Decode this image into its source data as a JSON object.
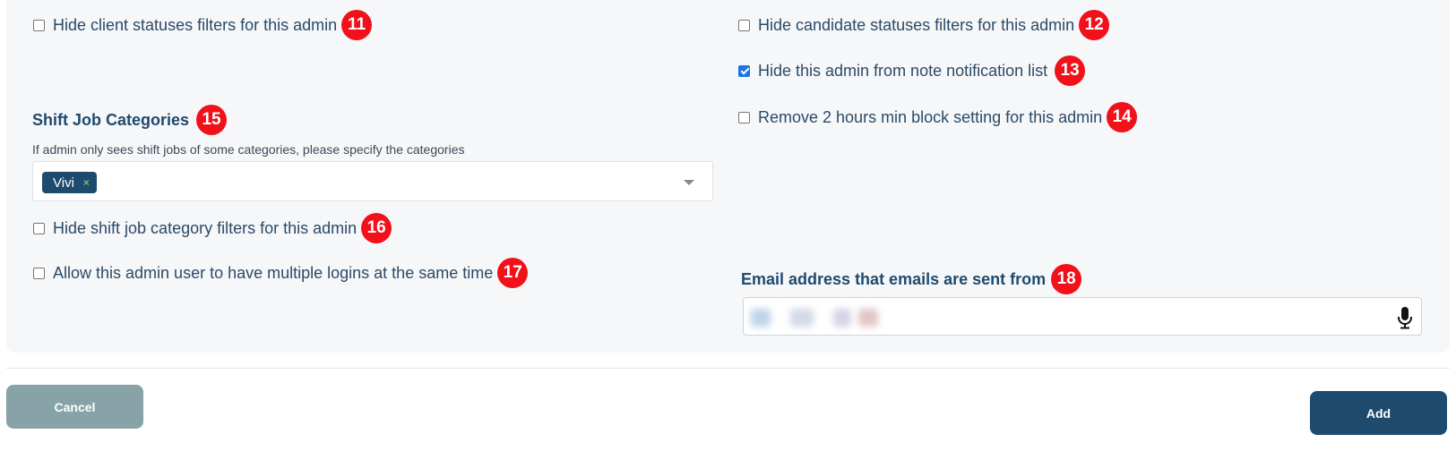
{
  "left_column": {
    "hide_client_statuses": {
      "label": "Hide client statuses filters for this admin",
      "checked": false,
      "badge": "11"
    },
    "shift_job_categories": {
      "heading": "Shift Job Categories",
      "badge": "15",
      "hint": "If admin only sees shift jobs of some categories, please specify the categories",
      "selected_tag": "Vivi",
      "tag_remove": "×"
    },
    "hide_shift_job_category": {
      "label": "Hide shift job category filters for this admin",
      "checked": false,
      "badge": "16"
    },
    "allow_multiple_logins": {
      "label": "Allow this admin user to have multiple logins at the same time",
      "checked": false,
      "badge": "17"
    }
  },
  "right_column": {
    "hide_candidate_statuses": {
      "label": "Hide candidate statuses filters for this admin",
      "checked": false,
      "badge": "12"
    },
    "hide_from_note_notification": {
      "label": "Hide this admin from note notification list",
      "checked": true,
      "badge": "13"
    },
    "remove_min_block": {
      "label": "Remove 2 hours min block setting for this admin",
      "checked": false,
      "badge": "14"
    },
    "email_sender": {
      "heading": "Email address that emails are sent from",
      "badge": "18",
      "value_redacted": true
    }
  },
  "footer": {
    "cancel_label": "Cancel",
    "add_label": "Add"
  },
  "colors": {
    "badge": "#f2101a",
    "primary": "#1e4a6e",
    "cancel": "#87a3a8",
    "checkbox_checked": "#1a73e8"
  },
  "icons": [
    "caret-down-icon",
    "microphone-icon",
    "close-icon"
  ]
}
